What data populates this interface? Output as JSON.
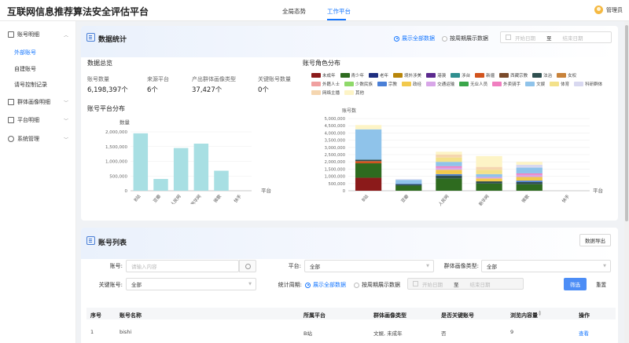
{
  "app_title": "互联网信息推荐算法安全评估平台",
  "top_tabs": [
    "全局态势",
    "工作平台"
  ],
  "user_name": "管理员",
  "sidebar": {
    "groups": [
      {
        "label": "账号明细",
        "items": [
          "外部账号",
          "自建账号",
          "请号控制记录"
        ]
      },
      {
        "label": "群体画像明细"
      },
      {
        "label": "平台明细"
      },
      {
        "label": "系统管理"
      }
    ]
  },
  "stats_panel": {
    "title": "数据统计",
    "radio_all": "展示全部数据",
    "radio_period": "按周期展示数据",
    "date_start": "开始日期",
    "date_sep": "至",
    "date_end": "结束日期",
    "overview_title": "数据总览",
    "stats": [
      {
        "label": "账号数量",
        "value": "6,198,397个"
      },
      {
        "label": "来源平台",
        "value": "6个"
      },
      {
        "label": "产出群体画像类型",
        "value": "37,427个"
      },
      {
        "label": "关键账号数量",
        "value": "0个"
      }
    ],
    "platform_chart_title": "账号平台分布",
    "role_chart_title": "账号角色分布"
  },
  "legend": [
    {
      "name": "未成年",
      "color": "#8b1a1a"
    },
    {
      "name": "青少年",
      "color": "#2e6b1f"
    },
    {
      "name": "老年",
      "color": "#1f2f80"
    },
    {
      "name": "境外涉美",
      "color": "#b8860b"
    },
    {
      "name": "港澳",
      "color": "#5b2a8e"
    },
    {
      "name": "涉台",
      "color": "#2f8f8f"
    },
    {
      "name": "新疆",
      "color": "#d2541e"
    },
    {
      "name": "西藏宗教",
      "color": "#7a4a2a"
    },
    {
      "name": "法治",
      "color": "#2f4f4f"
    },
    {
      "name": "女权",
      "color": "#c8823a"
    },
    {
      "name": "外籍人士",
      "color": "#f0a0a0"
    },
    {
      "name": "少数民族",
      "color": "#8fd96a"
    },
    {
      "name": "宗教",
      "color": "#4a7fd6"
    },
    {
      "name": "政经",
      "color": "#f2c94c"
    },
    {
      "name": "交通运输",
      "color": "#d8a6e8"
    },
    {
      "name": "无业人员",
      "color": "#3aa64a"
    },
    {
      "name": "外卖骑手",
      "color": "#f07ec0"
    },
    {
      "name": "文娱",
      "color": "#8fc3ea"
    },
    {
      "name": "体育",
      "color": "#f3e18a"
    },
    {
      "name": "科研群体",
      "color": "#d8d8f0"
    },
    {
      "name": "网络主播",
      "color": "#f5d6b0"
    },
    {
      "name": "其他",
      "color": "#fdf4c6"
    }
  ],
  "chart_data": [
    {
      "type": "bar",
      "title": "账号平台分布",
      "ylabel": "数量",
      "xlabel": "平台",
      "categories": [
        "B站",
        "豆瓣",
        "人民网",
        "新华网",
        "微歌",
        "快手"
      ],
      "values": [
        1950000,
        400000,
        1450000,
        1600000,
        680000,
        0
      ],
      "ylim": [
        0,
        2000000
      ],
      "yticks": [
        "0",
        "500,000",
        "1,000,000",
        "1,500,000",
        "2,000,000"
      ],
      "color": "#a8dfe3"
    },
    {
      "type": "bar",
      "stacked": true,
      "title": "账号角色分布",
      "ylabel": "账号数",
      "xlabel": "平台",
      "categories": [
        "B站",
        "豆瓣",
        "人民网",
        "新华网",
        "微歌",
        "快手"
      ],
      "ylim": [
        0,
        5000000
      ],
      "yticks": [
        "0",
        "500,000",
        "1,000,000",
        "1,500,000",
        "2,000,000",
        "2,500,000",
        "3,000,000",
        "3,500,000",
        "4,000,000",
        "4,500,000",
        "5,000,000"
      ],
      "series": [
        {
          "name": "未成年",
          "values": [
            900000,
            0,
            0,
            0,
            0,
            0
          ]
        },
        {
          "name": "青少年",
          "values": [
            1000000,
            350000,
            850000,
            500000,
            450000,
            0
          ]
        },
        {
          "name": "新疆",
          "values": [
            150000,
            0,
            0,
            0,
            0,
            0
          ]
        },
        {
          "name": "法治",
          "values": [
            100000,
            100000,
            200000,
            150000,
            150000,
            0
          ]
        },
        {
          "name": "宗教",
          "values": [
            0,
            50000,
            100000,
            0,
            100000,
            0
          ]
        },
        {
          "name": "政经",
          "values": [
            0,
            0,
            300000,
            200000,
            250000,
            0
          ]
        },
        {
          "name": "交通运输",
          "values": [
            0,
            0,
            150000,
            100000,
            150000,
            0
          ]
        },
        {
          "name": "外卖骑手",
          "values": [
            0,
            0,
            100000,
            0,
            100000,
            0
          ]
        },
        {
          "name": "文娱",
          "values": [
            2100000,
            250000,
            300000,
            200000,
            400000,
            0
          ]
        },
        {
          "name": "体育",
          "values": [
            0,
            0,
            300000,
            300000,
            0,
            0
          ]
        },
        {
          "name": "科研群体",
          "values": [
            0,
            50000,
            0,
            0,
            200000,
            0
          ]
        },
        {
          "name": "网络主播",
          "values": [
            0,
            0,
            200000,
            200000,
            0,
            0
          ]
        },
        {
          "name": "其他",
          "values": [
            300000,
            0,
            200000,
            750000,
            200000,
            0
          ]
        }
      ]
    }
  ],
  "list_panel": {
    "title": "账号列表",
    "export_btn": "数据导出",
    "filters": {
      "account_label": "账号:",
      "account_placeholder": "请输入内容",
      "platform_label": "平台:",
      "platform_value": "全部",
      "group_label": "群体画像类型:",
      "group_value": "全部",
      "key_label": "关键账号:",
      "key_value": "全部",
      "period_label": "统计周期:",
      "radio_all": "展示全部数据",
      "radio_period": "按周期展示数据",
      "date_start": "开始日期",
      "date_sep": "至",
      "date_end": "结束日期",
      "filter_btn": "筛选",
      "reset_btn": "重置"
    },
    "columns": [
      "序号",
      "账号名称",
      "所属平台",
      "群体画像类型",
      "是否关键账号",
      "浏览内容量",
      "操作"
    ],
    "rows": [
      {
        "index": "1",
        "name": "bishi",
        "platform": "B站",
        "groups": "文娱, 未成年",
        "is_key": "否",
        "views": "9",
        "action": "查看"
      }
    ]
  }
}
